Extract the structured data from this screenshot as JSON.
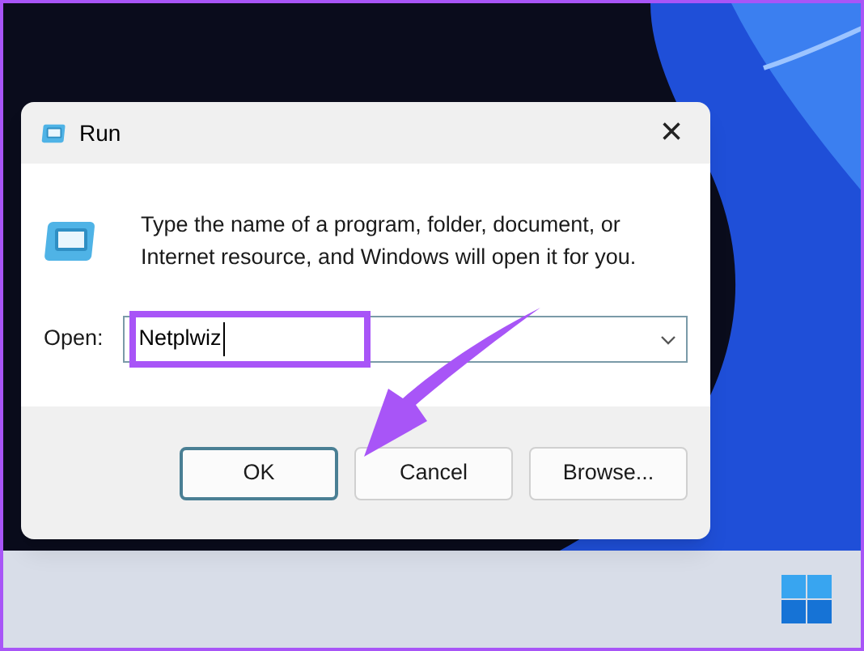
{
  "window": {
    "title": "Run",
    "close": "×"
  },
  "description": "Type the name of a program, folder, document, or Internet resource, and Windows will open it for you.",
  "open_field": {
    "label": "Open:",
    "value": "Netplwiz"
  },
  "buttons": [
    {
      "label": "OK",
      "selected": true
    },
    {
      "label": "Cancel",
      "selected": false
    },
    {
      "label": "Browse...",
      "selected": false
    }
  ]
}
